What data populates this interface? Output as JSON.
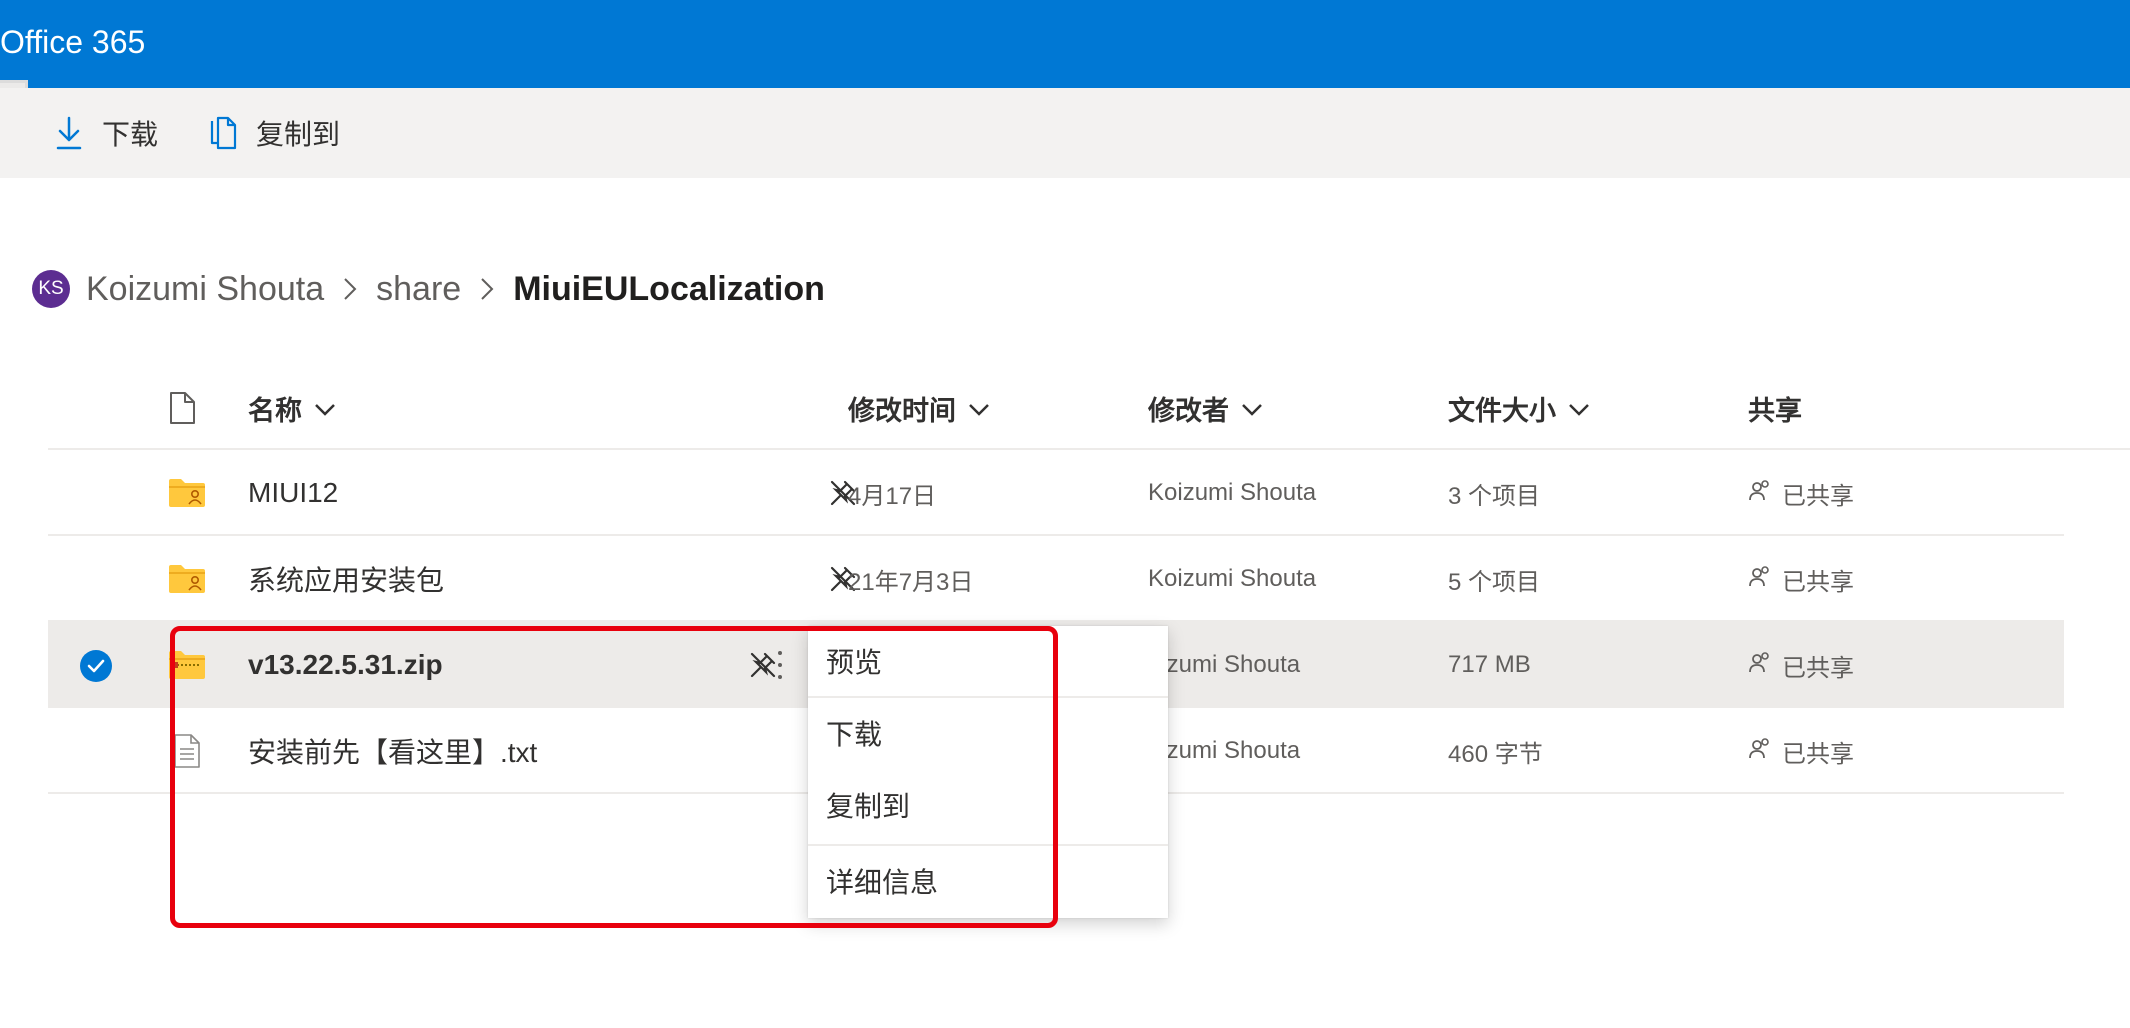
{
  "app": {
    "title": "Office 365"
  },
  "commands": {
    "download": "下载",
    "copy_to": "复制到"
  },
  "breadcrumb": {
    "avatar_initials": "KS",
    "items": [
      "Koizumi Shouta",
      "share",
      "MiuiEULocalization"
    ]
  },
  "columns": {
    "name": "名称",
    "modified": "修改时间",
    "modified_by": "修改者",
    "size": "文件大小",
    "sharing": "共享"
  },
  "files": [
    {
      "name": "MIUI12",
      "type": "shared-folder",
      "modified": "4月17日",
      "modified_by": "Koizumi Shouta",
      "size": "3 个项目",
      "sharing": "已共享",
      "selected": false
    },
    {
      "name": "系统应用安装包",
      "type": "shared-folder",
      "modified": "21年7月3日",
      "modified_by": "Koizumi Shouta",
      "size": "5 个项目",
      "sharing": "已共享",
      "selected": false
    },
    {
      "name": "v13.22.5.31.zip",
      "type": "zip",
      "modified": "",
      "modified_by": "oizumi Shouta",
      "size": "717 MB",
      "sharing": "已共享",
      "selected": true
    },
    {
      "name": "安装前先【看这里】.txt",
      "type": "txt",
      "modified": "",
      "modified_by": "oizumi Shouta",
      "size": "460 字节",
      "sharing": "已共享",
      "selected": false
    }
  ],
  "context_menu": {
    "items": [
      "预览",
      "下载",
      "复制到",
      "详细信息"
    ]
  },
  "colors": {
    "brand": "#0078d4",
    "folder": "#ffc83d",
    "avatar": "#5c2d91",
    "highlight": "#e8000d"
  },
  "icons": {
    "download": "download-icon",
    "copy": "copy-icon",
    "file_header": "document-icon",
    "pin": "pin-off-icon",
    "sharing": "people-icon",
    "more": "more-vertical-icon"
  }
}
